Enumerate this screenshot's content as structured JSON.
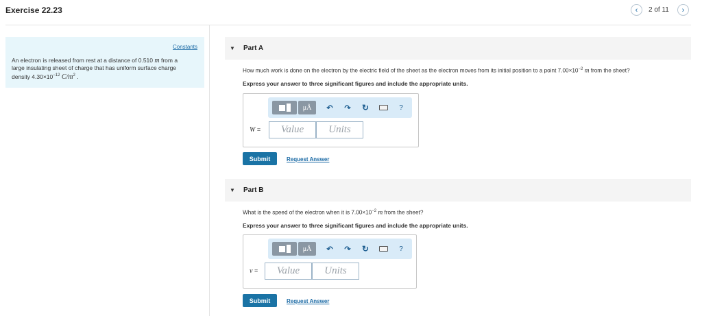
{
  "header": {
    "title": "Exercise 22.23",
    "page_count": "2 of 11",
    "prev_icon": "‹",
    "next_icon": "›"
  },
  "constants": {
    "link_label": "Constants",
    "line1_pre": "An electron is released from rest at a distance of 0.510 ",
    "line1_unit": "m",
    "line1_post": " from a",
    "line2": "large insulating sheet of charge that has uniform surface charge",
    "line3_pre": "density 4.30×10",
    "line3_exp": "−12",
    "line3_unit": "C/m",
    "line3_unit_exp": "2",
    "line3_post": " ."
  },
  "parts": [
    {
      "label": "Part A",
      "question_pre": "How much work is done on the electron by the electric field of the sheet as the electron moves from its initial position to a point 7.00×10",
      "question_exp": "−2",
      "question_unit": "m",
      "question_post": " from the sheet?",
      "instruction": "Express your answer to three significant figures and include the appropriate units.",
      "variable": "W",
      "equals": " =",
      "value_placeholder": "Value",
      "units_placeholder": "Units",
      "submit_label": "Submit",
      "request_label": "Request Answer"
    },
    {
      "label": "Part B",
      "question_pre": "What is the speed of the electron when it is 7.00×10",
      "question_exp": "−2",
      "question_unit": "m",
      "question_post": " from the sheet?",
      "instruction": "Express your answer to three significant figures and include the appropriate units.",
      "variable": "v",
      "equals": " =",
      "value_placeholder": "Value",
      "units_placeholder": "Units",
      "submit_label": "Submit",
      "request_label": "Request Answer"
    }
  ],
  "toolbar": {
    "units_label": "μÅ",
    "undo_icon": "↶",
    "redo_icon": "↷",
    "reset_icon": "↻",
    "help_label": "?"
  },
  "colors": {
    "accent": "#1a73a5",
    "constants_bg": "#e7f6fb",
    "toolbar_bg": "#d9ebf8"
  }
}
